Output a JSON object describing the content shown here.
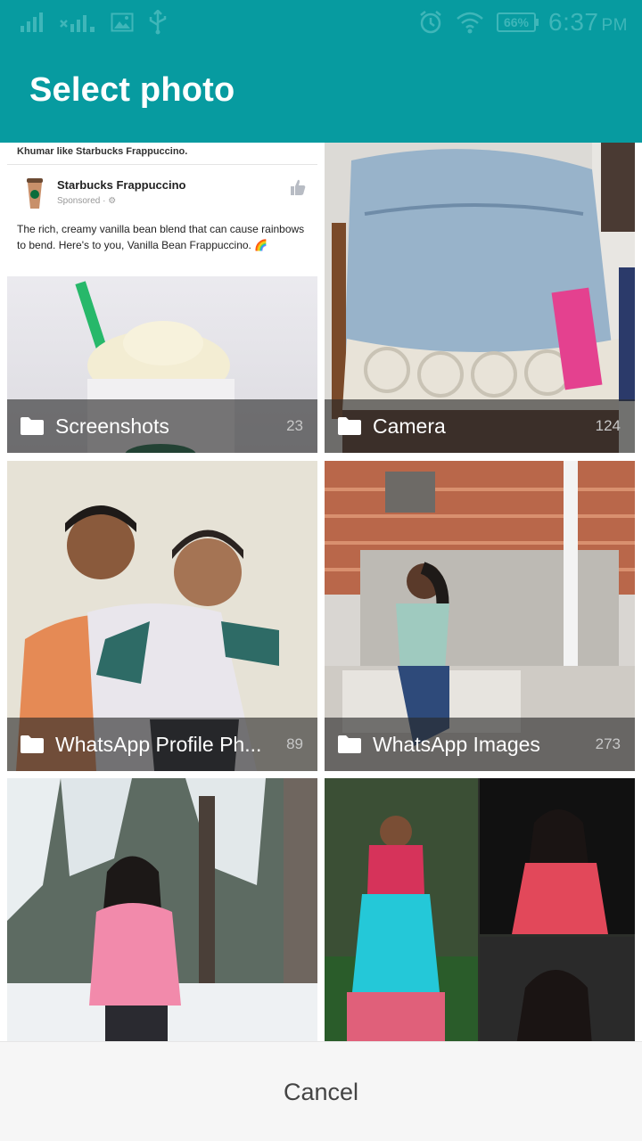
{
  "status_bar": {
    "battery": "66%",
    "time": "6:37",
    "ampm": "PM"
  },
  "header": {
    "title": "Select photo"
  },
  "albums": [
    {
      "name": "Screenshots",
      "count": "23"
    },
    {
      "name": "Camera",
      "count": "124"
    },
    {
      "name": "WhatsApp Profile Ph...",
      "count": "89"
    },
    {
      "name": "WhatsApp Images",
      "count": "273"
    }
  ],
  "screenshot_preview": {
    "activity": "Khumar like Starbucks Frappuccino.",
    "page_name": "Starbucks Frappuccino",
    "sponsored": "Sponsored · ⚙",
    "post_text": "The rich, creamy vanilla bean blend that can cause rainbows to bend. Here's to you, Vanilla Bean Frappuccino. 🌈"
  },
  "footer": {
    "cancel_label": "Cancel"
  },
  "colors": {
    "header": "#079ba0",
    "caption_overlay": "#282828"
  }
}
